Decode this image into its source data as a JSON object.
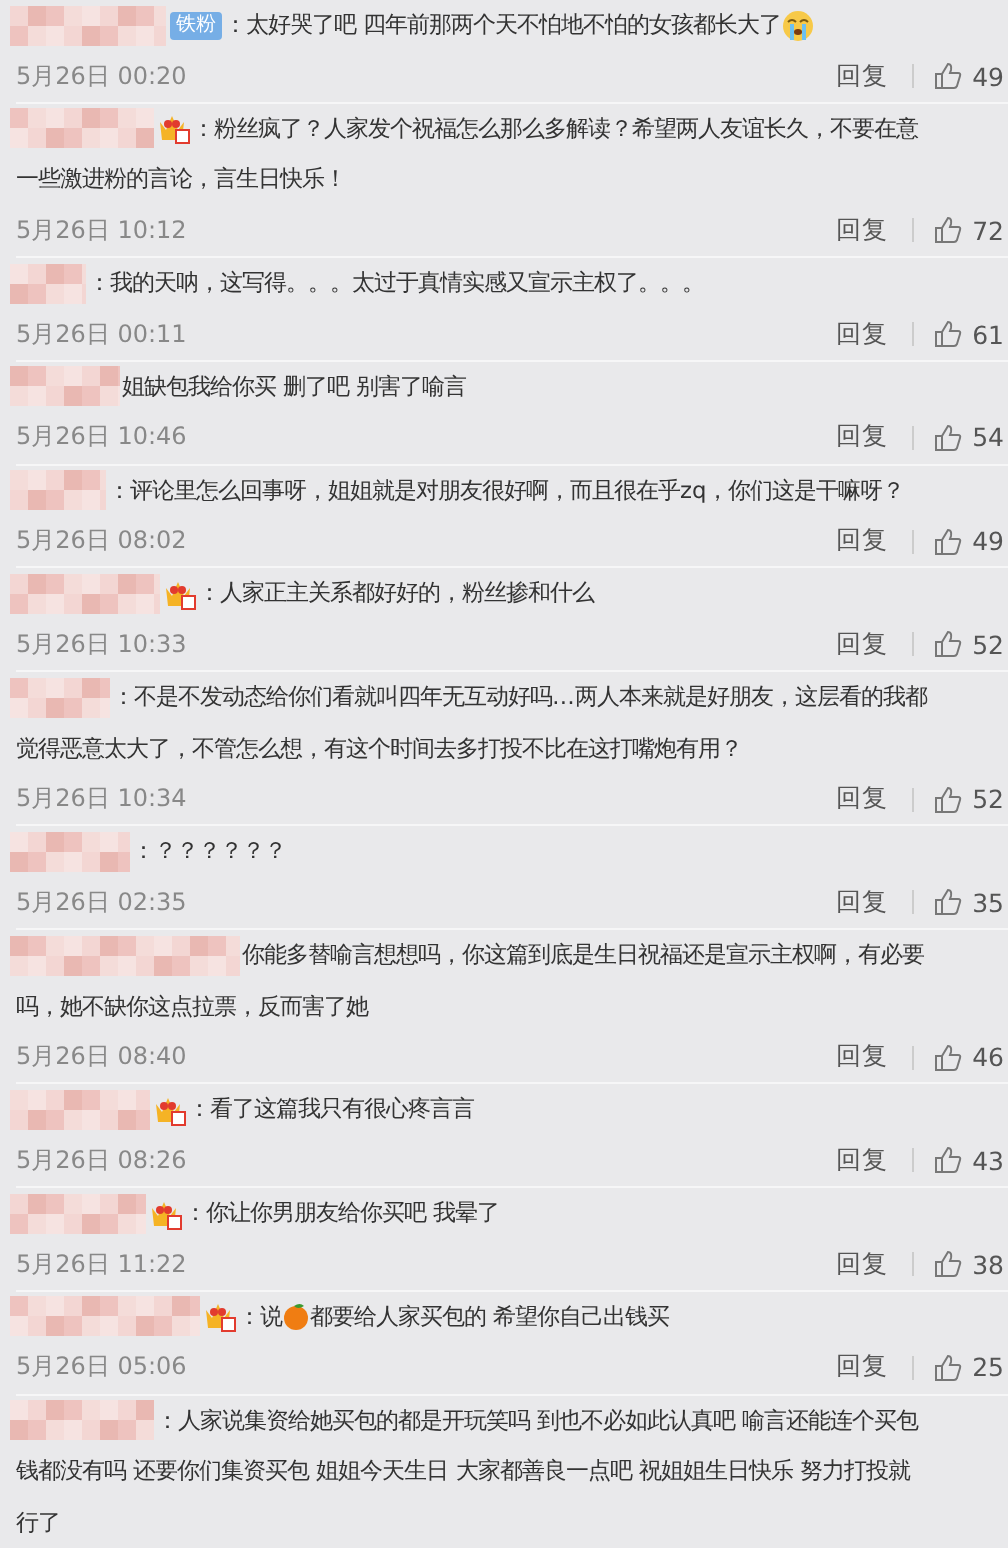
{
  "comments": [
    {
      "fan_badge": "铁粉",
      "lines": [
        [
          {
            "kind": "text",
            "text": "：太好哭了吧 四年前那两个天不怕地不怕的女孩都长大了"
          },
          {
            "kind": "crying_emoji"
          }
        ]
      ],
      "time": "5月26日 00:20",
      "reply": "回复",
      "likes": "49"
    },
    {
      "vip": true,
      "lines": [
        [
          {
            "kind": "text",
            "text": "：粉丝疯了？人家发个祝福怎么那么多解读？希望两人友谊长久，不要在意"
          }
        ],
        [
          {
            "kind": "text",
            "text": "一些激进粉的言论，言生日快乐！"
          }
        ]
      ],
      "time": "5月26日 10:12",
      "reply": "回复",
      "likes": "72"
    },
    {
      "lines": [
        [
          {
            "kind": "text",
            "text": "：我的天呐，这写得。。。太过于真情实感又宣示主权了。。。"
          }
        ]
      ],
      "time": "5月26日 00:11",
      "reply": "回复",
      "likes": "61"
    },
    {
      "lines": [
        [
          {
            "kind": "text",
            "text": "姐缺包我给你买 删了吧 别害了喻言"
          }
        ]
      ],
      "time": "5月26日 10:46",
      "reply": "回复",
      "likes": "54"
    },
    {
      "lines": [
        [
          {
            "kind": "text",
            "text": "：评论里怎么回事呀，姐姐就是对朋友很好啊，而且很在乎zq，你们这是干嘛呀？"
          }
        ]
      ],
      "time": "5月26日 08:02",
      "reply": "回复",
      "likes": "49"
    },
    {
      "vip": true,
      "lines": [
        [
          {
            "kind": "text",
            "text": "：人家正主关系都好好的，粉丝掺和什么"
          }
        ]
      ],
      "time": "5月26日 10:33",
      "reply": "回复",
      "likes": "52"
    },
    {
      "lines": [
        [
          {
            "kind": "text",
            "text": "：不是不发动态给你们看就叫四年无互动好吗…两人本来就是好朋友，这层看的我都"
          }
        ],
        [
          {
            "kind": "text",
            "text": "觉得恶意太大了，不管怎么想，有这个时间去多打投不比在这打嘴炮有用？"
          }
        ]
      ],
      "time": "5月26日 10:34",
      "reply": "回复",
      "likes": "52"
    },
    {
      "lines": [
        [
          {
            "kind": "text",
            "text": "：？？？？？？"
          }
        ]
      ],
      "time": "5月26日 02:35",
      "reply": "回复",
      "likes": "35"
    },
    {
      "lines": [
        [
          {
            "kind": "text",
            "text": "你能多替喻言想想吗，你这篇到底是生日祝福还是宣示主权啊，有必要"
          }
        ],
        [
          {
            "kind": "text",
            "text": "吗，她不缺你这点拉票，反而害了她"
          }
        ]
      ],
      "time": "5月26日 08:40",
      "reply": "回复",
      "likes": "46"
    },
    {
      "vip": true,
      "lines": [
        [
          {
            "kind": "text",
            "text": "：看了这篇我只有很心疼言言"
          }
        ]
      ],
      "time": "5月26日 08:26",
      "reply": "回复",
      "likes": "43"
    },
    {
      "vip": true,
      "lines": [
        [
          {
            "kind": "text",
            "text": "：你让你男朋友给你买吧 我晕了"
          }
        ]
      ],
      "time": "5月26日 11:22",
      "reply": "回复",
      "likes": "38"
    },
    {
      "vip": true,
      "lines": [
        [
          {
            "kind": "text",
            "text": "：说"
          },
          {
            "kind": "tangerine_emoji"
          },
          {
            "kind": "text",
            "text": "都要给人家买包的 希望你自己出钱买"
          }
        ]
      ],
      "time": "5月26日 05:06",
      "reply": "回复",
      "likes": "25"
    },
    {
      "lines": [
        [
          {
            "kind": "text",
            "text": "：人家说集资给她买包的都是开玩笑吗 到也不必如此认真吧 喻言还能连个买包"
          }
        ],
        [
          {
            "kind": "text",
            "text": "钱都没有吗 还要你们集资买包 姐姐今天生日 大家都善良一点吧 祝姐姐生日快乐 努力打投就"
          }
        ],
        [
          {
            "kind": "text",
            "text": "行了"
          }
        ]
      ]
    }
  ]
}
